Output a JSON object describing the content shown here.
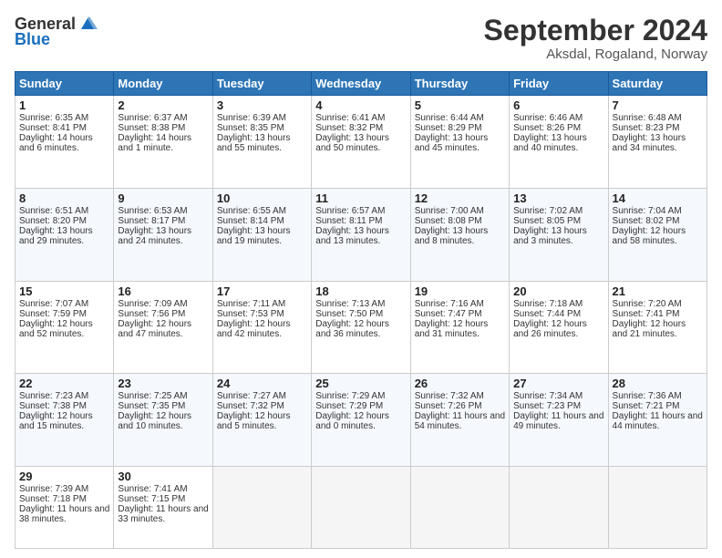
{
  "header": {
    "logo_general": "General",
    "logo_blue": "Blue",
    "month_title": "September 2024",
    "location": "Aksdal, Rogaland, Norway"
  },
  "columns": [
    "Sunday",
    "Monday",
    "Tuesday",
    "Wednesday",
    "Thursday",
    "Friday",
    "Saturday"
  ],
  "weeks": [
    [
      {
        "day": "1",
        "sunrise": "Sunrise: 6:35 AM",
        "sunset": "Sunset: 8:41 PM",
        "daylight": "Daylight: 14 hours and 6 minutes."
      },
      {
        "day": "2",
        "sunrise": "Sunrise: 6:37 AM",
        "sunset": "Sunset: 8:38 PM",
        "daylight": "Daylight: 14 hours and 1 minute."
      },
      {
        "day": "3",
        "sunrise": "Sunrise: 6:39 AM",
        "sunset": "Sunset: 8:35 PM",
        "daylight": "Daylight: 13 hours and 55 minutes."
      },
      {
        "day": "4",
        "sunrise": "Sunrise: 6:41 AM",
        "sunset": "Sunset: 8:32 PM",
        "daylight": "Daylight: 13 hours and 50 minutes."
      },
      {
        "day": "5",
        "sunrise": "Sunrise: 6:44 AM",
        "sunset": "Sunset: 8:29 PM",
        "daylight": "Daylight: 13 hours and 45 minutes."
      },
      {
        "day": "6",
        "sunrise": "Sunrise: 6:46 AM",
        "sunset": "Sunset: 8:26 PM",
        "daylight": "Daylight: 13 hours and 40 minutes."
      },
      {
        "day": "7",
        "sunrise": "Sunrise: 6:48 AM",
        "sunset": "Sunset: 8:23 PM",
        "daylight": "Daylight: 13 hours and 34 minutes."
      }
    ],
    [
      {
        "day": "8",
        "sunrise": "Sunrise: 6:51 AM",
        "sunset": "Sunset: 8:20 PM",
        "daylight": "Daylight: 13 hours and 29 minutes."
      },
      {
        "day": "9",
        "sunrise": "Sunrise: 6:53 AM",
        "sunset": "Sunset: 8:17 PM",
        "daylight": "Daylight: 13 hours and 24 minutes."
      },
      {
        "day": "10",
        "sunrise": "Sunrise: 6:55 AM",
        "sunset": "Sunset: 8:14 PM",
        "daylight": "Daylight: 13 hours and 19 minutes."
      },
      {
        "day": "11",
        "sunrise": "Sunrise: 6:57 AM",
        "sunset": "Sunset: 8:11 PM",
        "daylight": "Daylight: 13 hours and 13 minutes."
      },
      {
        "day": "12",
        "sunrise": "Sunrise: 7:00 AM",
        "sunset": "Sunset: 8:08 PM",
        "daylight": "Daylight: 13 hours and 8 minutes."
      },
      {
        "day": "13",
        "sunrise": "Sunrise: 7:02 AM",
        "sunset": "Sunset: 8:05 PM",
        "daylight": "Daylight: 13 hours and 3 minutes."
      },
      {
        "day": "14",
        "sunrise": "Sunrise: 7:04 AM",
        "sunset": "Sunset: 8:02 PM",
        "daylight": "Daylight: 12 hours and 58 minutes."
      }
    ],
    [
      {
        "day": "15",
        "sunrise": "Sunrise: 7:07 AM",
        "sunset": "Sunset: 7:59 PM",
        "daylight": "Daylight: 12 hours and 52 minutes."
      },
      {
        "day": "16",
        "sunrise": "Sunrise: 7:09 AM",
        "sunset": "Sunset: 7:56 PM",
        "daylight": "Daylight: 12 hours and 47 minutes."
      },
      {
        "day": "17",
        "sunrise": "Sunrise: 7:11 AM",
        "sunset": "Sunset: 7:53 PM",
        "daylight": "Daylight: 12 hours and 42 minutes."
      },
      {
        "day": "18",
        "sunrise": "Sunrise: 7:13 AM",
        "sunset": "Sunset: 7:50 PM",
        "daylight": "Daylight: 12 hours and 36 minutes."
      },
      {
        "day": "19",
        "sunrise": "Sunrise: 7:16 AM",
        "sunset": "Sunset: 7:47 PM",
        "daylight": "Daylight: 12 hours and 31 minutes."
      },
      {
        "day": "20",
        "sunrise": "Sunrise: 7:18 AM",
        "sunset": "Sunset: 7:44 PM",
        "daylight": "Daylight: 12 hours and 26 minutes."
      },
      {
        "day": "21",
        "sunrise": "Sunrise: 7:20 AM",
        "sunset": "Sunset: 7:41 PM",
        "daylight": "Daylight: 12 hours and 21 minutes."
      }
    ],
    [
      {
        "day": "22",
        "sunrise": "Sunrise: 7:23 AM",
        "sunset": "Sunset: 7:38 PM",
        "daylight": "Daylight: 12 hours and 15 minutes."
      },
      {
        "day": "23",
        "sunrise": "Sunrise: 7:25 AM",
        "sunset": "Sunset: 7:35 PM",
        "daylight": "Daylight: 12 hours and 10 minutes."
      },
      {
        "day": "24",
        "sunrise": "Sunrise: 7:27 AM",
        "sunset": "Sunset: 7:32 PM",
        "daylight": "Daylight: 12 hours and 5 minutes."
      },
      {
        "day": "25",
        "sunrise": "Sunrise: 7:29 AM",
        "sunset": "Sunset: 7:29 PM",
        "daylight": "Daylight: 12 hours and 0 minutes."
      },
      {
        "day": "26",
        "sunrise": "Sunrise: 7:32 AM",
        "sunset": "Sunset: 7:26 PM",
        "daylight": "Daylight: 11 hours and 54 minutes."
      },
      {
        "day": "27",
        "sunrise": "Sunrise: 7:34 AM",
        "sunset": "Sunset: 7:23 PM",
        "daylight": "Daylight: 11 hours and 49 minutes."
      },
      {
        "day": "28",
        "sunrise": "Sunrise: 7:36 AM",
        "sunset": "Sunset: 7:21 PM",
        "daylight": "Daylight: 11 hours and 44 minutes."
      }
    ],
    [
      {
        "day": "29",
        "sunrise": "Sunrise: 7:39 AM",
        "sunset": "Sunset: 7:18 PM",
        "daylight": "Daylight: 11 hours and 38 minutes."
      },
      {
        "day": "30",
        "sunrise": "Sunrise: 7:41 AM",
        "sunset": "Sunset: 7:15 PM",
        "daylight": "Daylight: 11 hours and 33 minutes."
      },
      null,
      null,
      null,
      null,
      null
    ]
  ]
}
